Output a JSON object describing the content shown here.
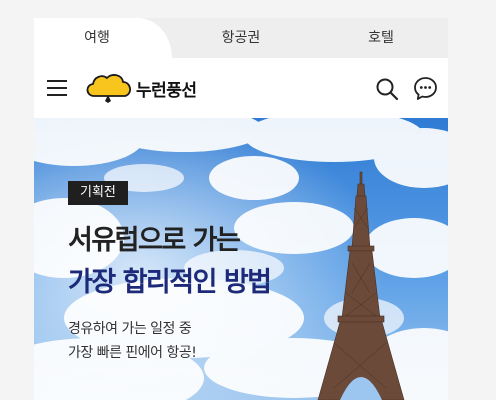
{
  "tabs": {
    "travel": "여행",
    "flight": "항공권",
    "hotel": "호텔"
  },
  "header": {
    "logo_text": "누런풍선",
    "icons": [
      "menu-icon",
      "balloon-logo-icon",
      "search-icon",
      "chat-icon"
    ]
  },
  "banner": {
    "badge": "기획전",
    "headline_line1": "서유럽으로 가는",
    "headline_line2": "가장 합리적인 방법",
    "sub_line1": "경유하여 가는 일정 중",
    "sub_line2": "가장 빠른 핀에어 항공!"
  },
  "colors": {
    "accent_yellow": "#f7c51e",
    "headline_navy": "#1d2a7a",
    "sky_blue": "#3f86d8"
  }
}
